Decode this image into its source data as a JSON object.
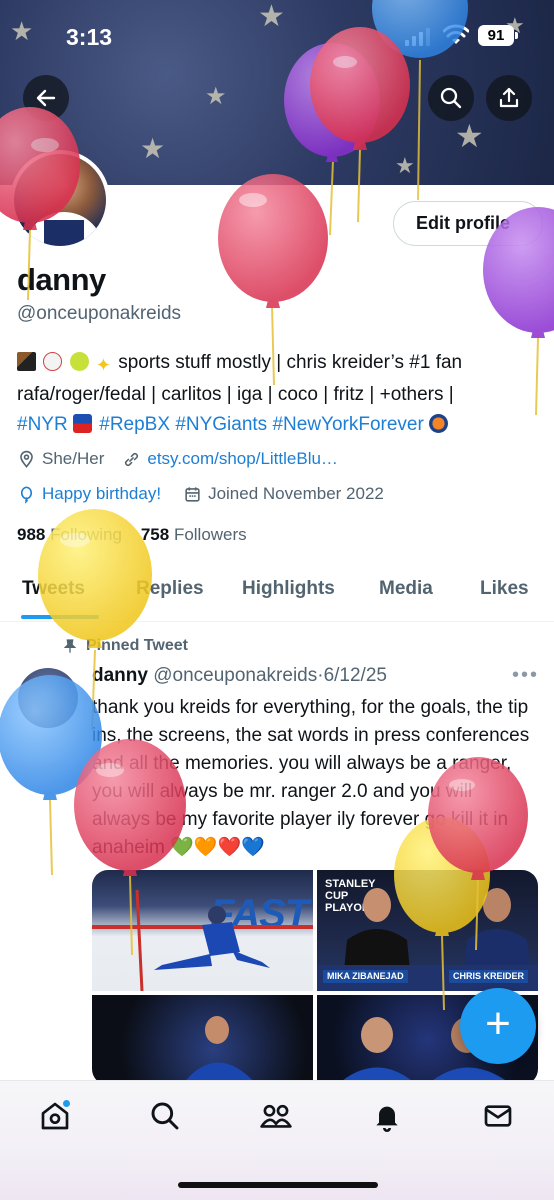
{
  "status_bar": {
    "time": "3:13",
    "battery": "91"
  },
  "header": {
    "edit_profile_label": "Edit profile"
  },
  "profile": {
    "name": "danny",
    "handle": "@onceuponakreids",
    "bio_line1": "sports stuff mostly | chris kreider’s #1 fan",
    "bio_line2": "rafa/roger/fedal | carlitos | iga | coco | fritz | +others |",
    "bio_tags": [
      "#NYR",
      "#RepBX",
      "#NYGiants",
      "#NewYorkForever"
    ],
    "pronouns": "She/Her",
    "website": "etsy.com/shop/LittleBlu…",
    "birthday": "Happy birthday!",
    "joined": "Joined November 2022",
    "following_count": "988",
    "following_label": "Following",
    "followers_count": "758",
    "followers_label": "Followers"
  },
  "tabs": [
    "Tweets",
    "Replies",
    "Highlights",
    "Media",
    "Likes"
  ],
  "pinned_tweet": {
    "pinned_label": "Pinned Tweet",
    "author_name": "danny",
    "author_handle": "@onceuponakreids",
    "separator": "·",
    "date": "6/12/25",
    "text": "thank you kreids for everything, for the goals, the tip ins, the screens, the sat words in press conferences and all the memories. you will always be a ranger, you will always be mr. ranger 2.0 and you will always be my favorite player ily forever go kill it in anaheim 💚🧡❤️💙",
    "media": {
      "image1_text": "FAST",
      "image2_logo": "STANLEY CUP PLAYOFFS",
      "image2_names": [
        "MIKA ZIBANEJAD",
        "CHRIS KREIDER"
      ]
    }
  },
  "fab_label": "+",
  "nav": [
    "home-icon",
    "search-icon",
    "communities-icon",
    "notifications-icon",
    "messages-icon"
  ],
  "colors": {
    "accent": "#1d9bf0",
    "link": "#1d7ed4",
    "secondary_text": "#536471"
  }
}
